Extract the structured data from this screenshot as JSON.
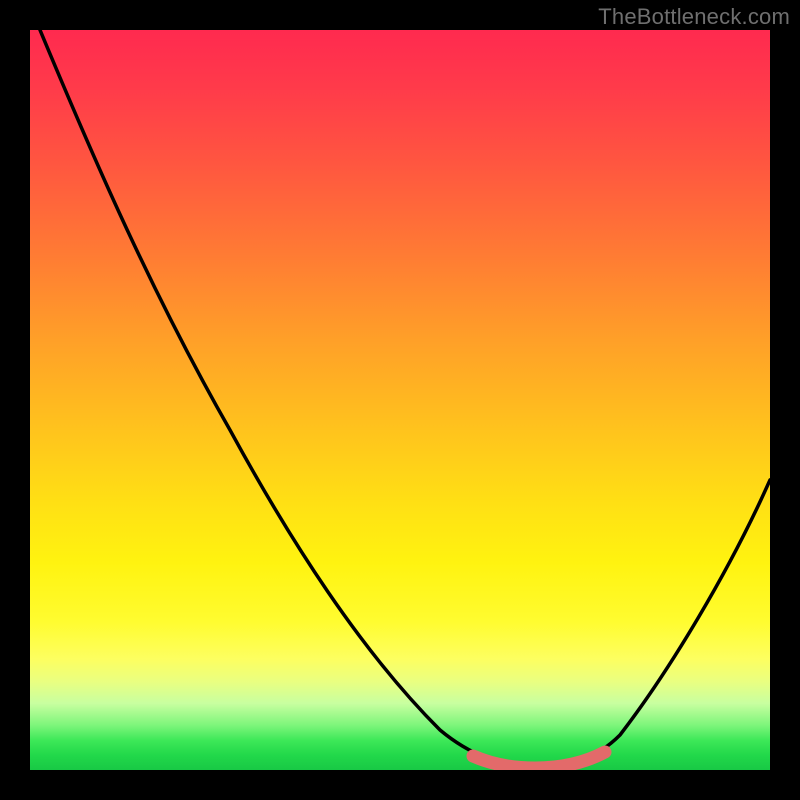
{
  "watermark": {
    "text": "TheBottleneck.com"
  },
  "colors": {
    "background": "#000000",
    "curve_stroke": "#000000",
    "marker_stroke": "#e36a6a",
    "gradient_top": "#ff2a4f",
    "gradient_bottom": "#18c945"
  },
  "chart_data": {
    "type": "line",
    "title": "",
    "xlabel": "",
    "ylabel": "",
    "xlim": [
      0,
      100
    ],
    "ylim": [
      0,
      100
    ],
    "series": [
      {
        "name": "bottleneck-curve",
        "x": [
          0,
          6,
          12,
          18,
          24,
          30,
          36,
          42,
          48,
          54,
          58,
          62,
          66,
          70,
          74,
          78,
          82,
          86,
          90,
          94,
          98,
          100
        ],
        "values": [
          100,
          92,
          84,
          75,
          66,
          57,
          48,
          39,
          30,
          20,
          13,
          7,
          3,
          1,
          0.5,
          1,
          4,
          10,
          18,
          27,
          36,
          40
        ]
      }
    ],
    "highlight_segment": {
      "name": "optimal-range",
      "x_start": 62,
      "x_end": 78,
      "note": "flat minimum of the curve, marked with thick salmon stroke"
    },
    "gradient_note": "vertical gradient from red (high bottleneck) at top to green (no bottleneck) at bottom"
  }
}
